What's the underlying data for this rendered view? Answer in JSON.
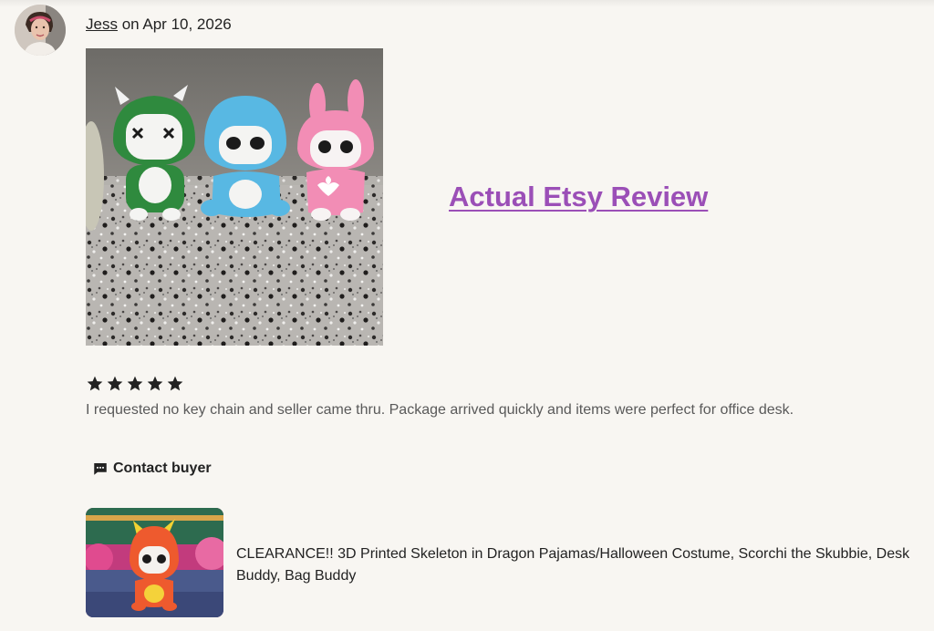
{
  "review": {
    "reviewer_name": "Jess",
    "date_text": " on Apr 10, 2026",
    "rating": 5,
    "rating_max": 5,
    "text": "I requested no key chain and seller came thru. Package arrived quickly and items were perfect for office desk.",
    "photo_icon": "review-photo"
  },
  "overlay": {
    "title": "Actual Etsy Review",
    "color": "#9b4fb7"
  },
  "actions": {
    "contact_buyer_label": "Contact buyer",
    "contact_buyer_icon": "chat-bubble-icon"
  },
  "listing": {
    "title": "CLEARANCE!! 3D Printed Skeleton in Dragon Pajamas/Halloween Costume, Scorchi the Skubbie, Desk Buddy, Bag Buddy"
  },
  "colors": {
    "background": "#f8f6f2",
    "star": "#222222",
    "text_secondary": "#595959"
  }
}
